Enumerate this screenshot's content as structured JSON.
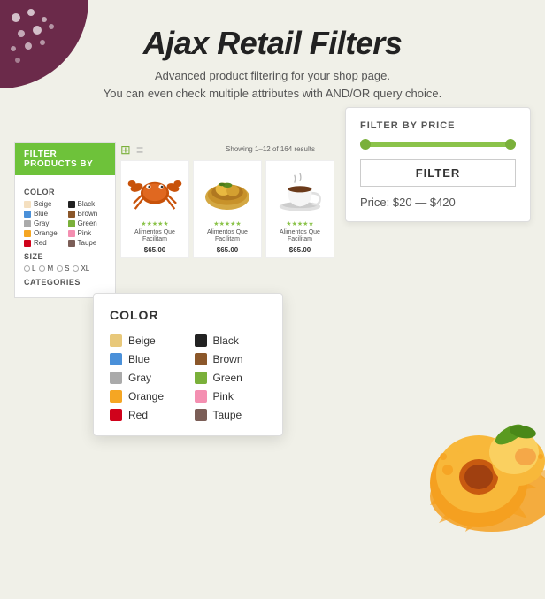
{
  "header": {
    "title": "Ajax Retail Filters",
    "subtitle_line1": "Advanced product filtering for your shop page.",
    "subtitle_line2": "You can even check multiple attributes with AND/OR query choice."
  },
  "price_filter": {
    "title": "FILTER BY PRICE",
    "button_label": "FILTER",
    "price_label": "Price:",
    "price_min": "$20",
    "price_separator": "—",
    "price_max": "$420"
  },
  "sidebar": {
    "header": "FILTER PRODUCTS BY",
    "color_section": "COLOR",
    "colors_left": [
      {
        "name": "Beige",
        "hex": "#f5e0c0"
      },
      {
        "name": "Blue",
        "hex": "#4a90d9"
      },
      {
        "name": "Gray",
        "hex": "#aaa"
      },
      {
        "name": "Orange",
        "hex": "#f5a623"
      },
      {
        "name": "Red",
        "hex": "#d0021b"
      }
    ],
    "colors_right": [
      {
        "name": "Black",
        "hex": "#222"
      },
      {
        "name": "Brown",
        "hex": "#8b572a"
      },
      {
        "name": "Green",
        "hex": "#7ab03a"
      },
      {
        "name": "Pink",
        "hex": "#f48fb1"
      },
      {
        "name": "Taupe",
        "hex": "#7b5e57"
      }
    ],
    "size_section": "SIZE",
    "sizes": [
      "L",
      "M",
      "S",
      "XL"
    ],
    "categories_section": "CATEGORIES"
  },
  "toolbar": {
    "showing_text": "Showing 1–12 of 164 results"
  },
  "products": [
    {
      "stars": "★★★★★",
      "name": "Alimentos Que Facilitam",
      "price": "$65.00"
    },
    {
      "stars": "★★★★★",
      "name": "Alimentos Que Facilitam",
      "price": "$65.00"
    },
    {
      "stars": "★★★★★",
      "name": "Alimentos Que Facilitam",
      "price": "$65.00"
    }
  ],
  "color_popup": {
    "title": "COLOR",
    "colors": [
      {
        "name": "Beige",
        "hex": "#e8c87a"
      },
      {
        "name": "Black",
        "hex": "#222"
      },
      {
        "name": "Blue",
        "hex": "#4a90d9"
      },
      {
        "name": "Brown",
        "hex": "#8b572a"
      },
      {
        "name": "Gray",
        "hex": "#aaa"
      },
      {
        "name": "Green",
        "hex": "#7ab03a"
      },
      {
        "name": "Orange",
        "hex": "#f5a623"
      },
      {
        "name": "Pink",
        "hex": "#f48fb1"
      },
      {
        "name": "Red",
        "hex": "#d0021b"
      },
      {
        "name": "Taupe",
        "hex": "#7b5e57"
      }
    ]
  },
  "icons": {
    "grid_view": "⊞",
    "list_view": "≡"
  }
}
